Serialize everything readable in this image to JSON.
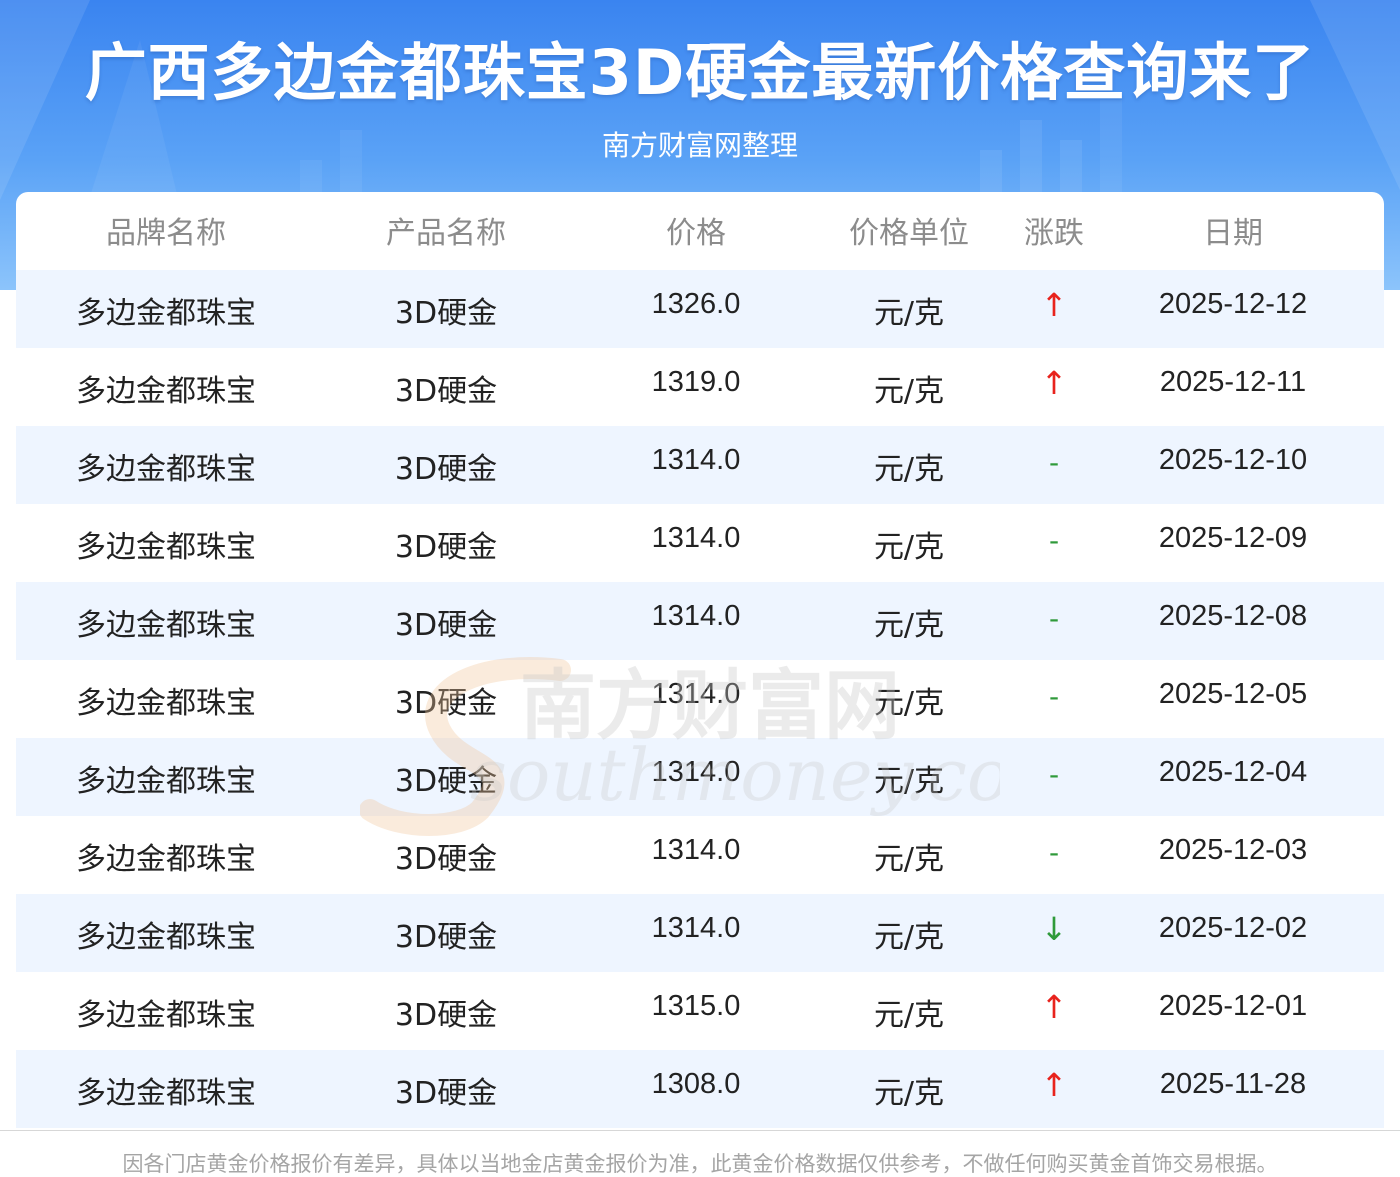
{
  "header": {
    "title": "广西多边金都珠宝3D硬金最新价格查询来了",
    "subtitle": "南方财富网整理"
  },
  "table": {
    "columns": [
      "品牌名称",
      "产品名称",
      "价格",
      "价格单位",
      "涨跌",
      "日期"
    ],
    "rows": [
      {
        "brand": "多边金都珠宝",
        "product": "3D硬金",
        "price": "1326.0",
        "unit": "元/克",
        "change": "↑",
        "change_type": "up",
        "date": "2025-12-12"
      },
      {
        "brand": "多边金都珠宝",
        "product": "3D硬金",
        "price": "1319.0",
        "unit": "元/克",
        "change": "↑",
        "change_type": "up",
        "date": "2025-12-11"
      },
      {
        "brand": "多边金都珠宝",
        "product": "3D硬金",
        "price": "1314.0",
        "unit": "元/克",
        "change": "-",
        "change_type": "flat",
        "date": "2025-12-10"
      },
      {
        "brand": "多边金都珠宝",
        "product": "3D硬金",
        "price": "1314.0",
        "unit": "元/克",
        "change": "-",
        "change_type": "flat",
        "date": "2025-12-09"
      },
      {
        "brand": "多边金都珠宝",
        "product": "3D硬金",
        "price": "1314.0",
        "unit": "元/克",
        "change": "-",
        "change_type": "flat",
        "date": "2025-12-08"
      },
      {
        "brand": "多边金都珠宝",
        "product": "3D硬金",
        "price": "1314.0",
        "unit": "元/克",
        "change": "-",
        "change_type": "flat",
        "date": "2025-12-05"
      },
      {
        "brand": "多边金都珠宝",
        "product": "3D硬金",
        "price": "1314.0",
        "unit": "元/克",
        "change": "-",
        "change_type": "flat",
        "date": "2025-12-04"
      },
      {
        "brand": "多边金都珠宝",
        "product": "3D硬金",
        "price": "1314.0",
        "unit": "元/克",
        "change": "-",
        "change_type": "flat",
        "date": "2025-12-03"
      },
      {
        "brand": "多边金都珠宝",
        "product": "3D硬金",
        "price": "1314.0",
        "unit": "元/克",
        "change": "↓",
        "change_type": "down",
        "date": "2025-12-02"
      },
      {
        "brand": "多边金都珠宝",
        "product": "3D硬金",
        "price": "1315.0",
        "unit": "元/克",
        "change": "↑",
        "change_type": "up",
        "date": "2025-12-01"
      },
      {
        "brand": "多边金都珠宝",
        "product": "3D硬金",
        "price": "1308.0",
        "unit": "元/克",
        "change": "↑",
        "change_type": "up",
        "date": "2025-11-28"
      }
    ]
  },
  "watermark": {
    "cn_text": "南方财富网",
    "en_text": "southmoney.com"
  },
  "footer": {
    "note": "因各门店黄金价格报价有差异，具体以当地金店黄金报价为准，此黄金价格数据仅供参考，不做任何购买黄金首饰交易根据。"
  },
  "colors": {
    "header_blue": "#3a84f0",
    "row_alt": "#eef5ff",
    "up": "#e8231d",
    "down_flat": "#2f9a3a"
  }
}
